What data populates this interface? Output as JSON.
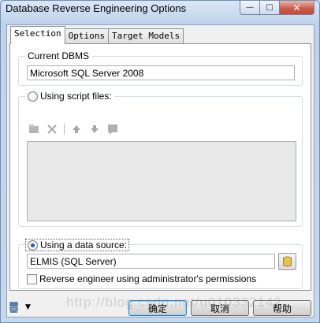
{
  "window": {
    "title": "Database Reverse Engineering Options"
  },
  "tabs": [
    {
      "label": "Selection",
      "active": true
    },
    {
      "label": "Options",
      "active": false
    },
    {
      "label": "Target Models",
      "active": false
    }
  ],
  "current_dbms": {
    "label": "Current DBMS",
    "value": "Microsoft SQL Server 2008"
  },
  "script_files": {
    "label": "Using script files:",
    "selected": false,
    "toolbar_icons": [
      "add-file-icon",
      "delete-icon",
      "move-up-icon",
      "move-down-icon",
      "properties-icon"
    ]
  },
  "data_source": {
    "label": "Using a data source:",
    "selected": true,
    "value": "ELMIS (SQL Server)",
    "admin_checkbox_label": "Reverse engineer using administrator's permissions",
    "admin_checked": false
  },
  "buttons": {
    "ok": "确定",
    "cancel": "取消",
    "help": "帮助"
  },
  "watermark": "http://blog.csdn.net/u010332142",
  "colors": {
    "accent": "#1e58b8",
    "window_frame": "#c5d7ee",
    "close_button": "#c9594a"
  }
}
